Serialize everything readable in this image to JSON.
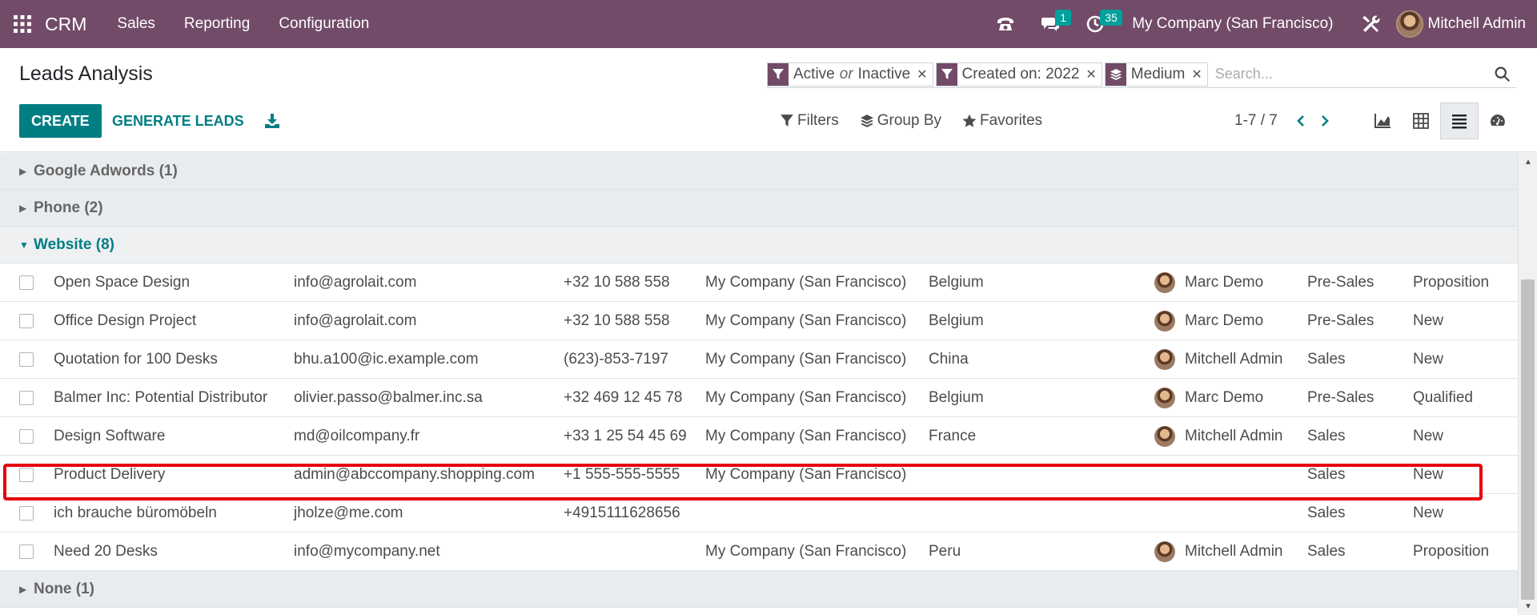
{
  "navbar": {
    "app_name": "CRM",
    "menus": [
      "Sales",
      "Reporting",
      "Configuration"
    ],
    "messages_badge": "1",
    "activities_badge": "35",
    "company": "My Company (San Francisco)",
    "user": "Mitchell Admin",
    "brand_color": "#714b67"
  },
  "control_panel": {
    "title": "Leads Analysis",
    "facets": [
      {
        "label": "Active",
        "separator": "or",
        "label2": "Inactive",
        "icon": "filter-icon"
      },
      {
        "label": "Created on: 2022",
        "icon": "filter-icon"
      },
      {
        "label": "Medium",
        "icon": "layers-icon"
      }
    ],
    "search_placeholder": "Search...",
    "create_label": "CREATE",
    "generate_label": "GENERATE LEADS",
    "filters_label": "Filters",
    "groupby_label": "Group By",
    "favorites_label": "Favorites",
    "pager": "1-7 / 7",
    "accent_color": "#017e84"
  },
  "groups": {
    "google": "Google Adwords (1)",
    "phone": "Phone (2)",
    "website": "Website (8)",
    "none": "None (1)"
  },
  "rows": [
    {
      "name": "Open Space Design",
      "email": "info@agrolait.com",
      "phone": "+32 10 588 558",
      "company": "My Company (San Francisco)",
      "country": "Belgium",
      "salesperson": "Marc Demo",
      "team": "Pre-Sales",
      "stage": "Proposition"
    },
    {
      "name": "Office Design Project",
      "email": "info@agrolait.com",
      "phone": "+32 10 588 558",
      "company": "My Company (San Francisco)",
      "country": "Belgium",
      "salesperson": "Marc Demo",
      "team": "Pre-Sales",
      "stage": "New"
    },
    {
      "name": "Quotation for 100 Desks",
      "email": "bhu.a100@ic.example.com",
      "phone": "(623)-853-7197",
      "company": "My Company (San Francisco)",
      "country": "China",
      "salesperson": "Mitchell Admin",
      "team": "Sales",
      "stage": "New"
    },
    {
      "name": "Balmer Inc: Potential Distributor",
      "email": "olivier.passo@balmer.inc.sa",
      "phone": "+32 469 12 45 78",
      "company": "My Company (San Francisco)",
      "country": "Belgium",
      "salesperson": "Marc Demo",
      "team": "Pre-Sales",
      "stage": "Qualified"
    },
    {
      "name": "Design Software",
      "email": "md@oilcompany.fr",
      "phone": "+33 1 25 54 45 69",
      "company": "My Company (San Francisco)",
      "country": "France",
      "salesperson": "Mitchell Admin",
      "team": "Sales",
      "stage": "New"
    },
    {
      "name": "Product Delivery",
      "email": "admin@abccompany.shopping.com",
      "phone": "+1 555-555-5555",
      "company": "My Company (San Francisco)",
      "country": "",
      "salesperson": "",
      "team": "Sales",
      "stage": "New"
    },
    {
      "name": "ich brauche büromöbeln",
      "email": "jholze@me.com",
      "phone": "+4915111628656",
      "company": "",
      "country": "",
      "salesperson": "",
      "team": "Sales",
      "stage": "New"
    },
    {
      "name": "Need 20 Desks",
      "email": "info@mycompany.net",
      "phone": "",
      "company": "My Company (San Francisco)",
      "country": "Peru",
      "salesperson": "Mitchell Admin",
      "team": "Sales",
      "stage": "Proposition"
    }
  ]
}
